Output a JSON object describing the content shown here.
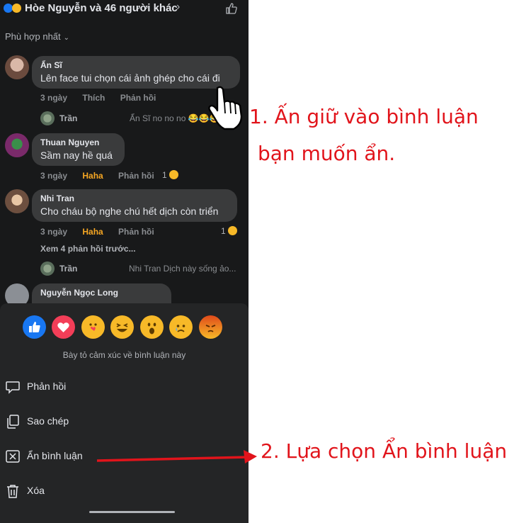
{
  "header": {
    "title": "Hòe Nguyễn và 46 người khác",
    "chevron": "›"
  },
  "sort": {
    "label": "Phù hợp nhất",
    "caret": "⌄"
  },
  "comments": [
    {
      "name": "Ẩn Sĩ",
      "text": "Lên face tui chọn cái ảnh ghép cho cái đi",
      "time": "3 ngày",
      "reaction": "Thích",
      "reply": "Phản hồi",
      "count": ""
    },
    {
      "name": "Thuan Nguyen",
      "text": "Sầm nay hề quá",
      "time": "3 ngày",
      "reaction": "Haha",
      "reply": "Phản hồi",
      "count": "1"
    },
    {
      "name": "Nhi Tran",
      "text": "Cho cháu bộ nghe chú hết dịch còn triển",
      "time": "3 ngày",
      "reaction": "Haha",
      "reply": "Phản hồi",
      "count": "1"
    },
    {
      "name": "Nguyễn Ngọc Long",
      "text": "",
      "time": "",
      "reaction": "",
      "reply": "",
      "count": ""
    }
  ],
  "replies": [
    {
      "name": "Trần",
      "text": "Ẩn Sĩ no no no 😂😂😂"
    },
    {
      "name": "Trần",
      "text": "Nhi Tran Dịch này sống ảo..."
    }
  ],
  "more_replies": "Xem 4 phản hồi trước...",
  "reactions": [
    "like",
    "love",
    "care",
    "haha",
    "wow",
    "sad",
    "angry"
  ],
  "reaction_caption": "Bày tỏ cảm xúc về bình luận này",
  "menu": [
    {
      "label": "Phản hồi",
      "icon": "speech-bubble-icon"
    },
    {
      "label": "Sao chép",
      "icon": "copy-icon"
    },
    {
      "label": "Ẩn bình luận",
      "icon": "hide-box-x-icon"
    },
    {
      "label": "Xóa",
      "icon": "trash-icon"
    }
  ],
  "annotations": {
    "step1_line1": "1. Ấn giữ vào bình luận",
    "step1_line2": "bạn muốn ẩn.",
    "step2": "2. Lựa chọn Ẩn bình luận"
  },
  "colors": {
    "background": "#18191a",
    "sheet": "#242526",
    "bubble": "#3a3b3c",
    "text": "#e4e6eb",
    "muted": "#b0b3b8",
    "haha": "#f5a623",
    "annotation_red": "#e1141b",
    "like_blue": "#1877f2",
    "love_red": "#f33e58"
  }
}
